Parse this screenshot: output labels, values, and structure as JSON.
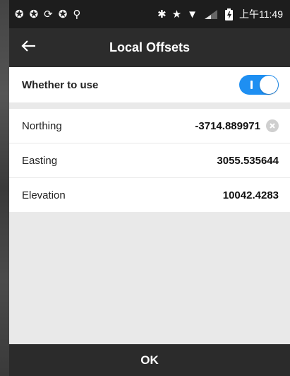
{
  "status_bar": {
    "left_icons": [
      "notification-icon",
      "notification-icon",
      "sync-icon",
      "notification-icon",
      "location-icon"
    ],
    "right_icons": [
      "bluetooth-icon",
      "star-icon",
      "wifi-icon",
      "signal-icon",
      "battery-icon"
    ],
    "time": "上午11:49"
  },
  "header": {
    "title": "Local Offsets",
    "back_icon": "arrow-left-icon"
  },
  "settings": {
    "use_toggle": {
      "label": "Whether to use",
      "enabled": true
    },
    "fields": [
      {
        "label": "Northing",
        "value": "-3714.889971",
        "clear_icon": "clear-icon"
      },
      {
        "label": "Easting",
        "value": "3055.535644"
      },
      {
        "label": "Elevation",
        "value": "10042.4283"
      }
    ]
  },
  "footer": {
    "ok_label": "OK"
  },
  "colors": {
    "toggle_on": "#1e8ff2",
    "app_bar": "#2c2c2c",
    "status_bar": "#1d1d1d",
    "background": "#e9e9e9"
  }
}
